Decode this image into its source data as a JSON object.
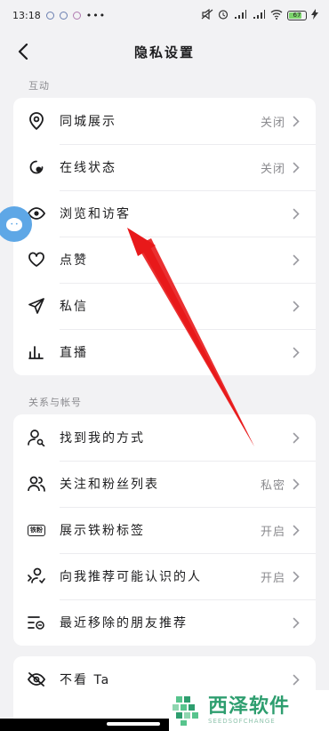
{
  "status_bar": {
    "time": "13:18",
    "battery": "67"
  },
  "header": {
    "title": "隐私设置"
  },
  "sections": [
    {
      "label": "互动",
      "items": [
        {
          "label": "同城展示",
          "value": "关闭",
          "icon": "location-pin-icon"
        },
        {
          "label": "在线状态",
          "value": "关闭",
          "icon": "online-status-icon"
        },
        {
          "label": "浏览和访客",
          "value": "",
          "icon": "eye-icon"
        },
        {
          "label": "点赞",
          "value": "",
          "icon": "heart-icon"
        },
        {
          "label": "私信",
          "value": "",
          "icon": "send-icon"
        },
        {
          "label": "直播",
          "value": "",
          "icon": "bars-icon"
        }
      ]
    },
    {
      "label": "关系与帐号",
      "items": [
        {
          "label": "找到我的方式",
          "value": "",
          "icon": "user-search-icon"
        },
        {
          "label": "关注和粉丝列表",
          "value": "私密",
          "icon": "users-icon"
        },
        {
          "label": "展示铁粉标签",
          "value": "开启",
          "icon": "fan-badge-icon"
        },
        {
          "label": "向我推荐可能认识的人",
          "value": "开启",
          "icon": "recommend-people-icon"
        },
        {
          "label": "最近移除的朋友推荐",
          "value": "",
          "icon": "removed-list-icon"
        }
      ]
    },
    {
      "label": "",
      "items": [
        {
          "label": "不看 Ta",
          "value": "",
          "icon": "eye-off-icon"
        }
      ]
    }
  ],
  "badge_text": "铁粉",
  "watermark": {
    "main": "西泽软件",
    "sub": "SEEDSOFCHANGE"
  }
}
